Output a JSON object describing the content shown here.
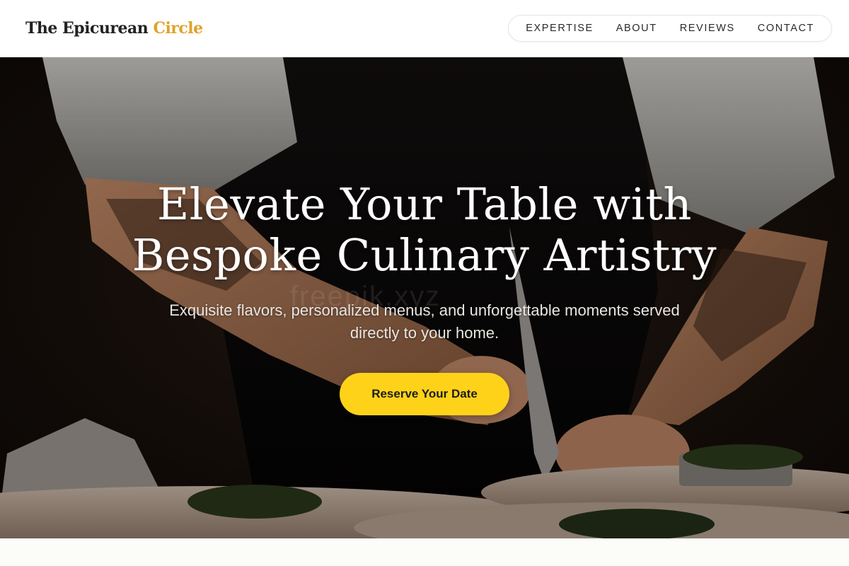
{
  "header": {
    "logo_main": "The Epicurean",
    "logo_accent": "Circle",
    "nav": [
      "EXPERTISE",
      "ABOUT",
      "REVIEWS",
      "CONTACT"
    ]
  },
  "hero": {
    "title_line1": "Elevate Your Table with",
    "title_line2": "Bespoke Culinary Artistry",
    "subtitle_line1": "Exquisite flavors, personalized menus, and unforgettable moments served",
    "subtitle_line2": "directly to your home.",
    "cta_label": "Reserve Your Date",
    "watermark": "freepik.xyz"
  },
  "colors": {
    "accent": "#e0a22a",
    "cta_background": "#ffd21a",
    "text_dark": "#222222"
  }
}
